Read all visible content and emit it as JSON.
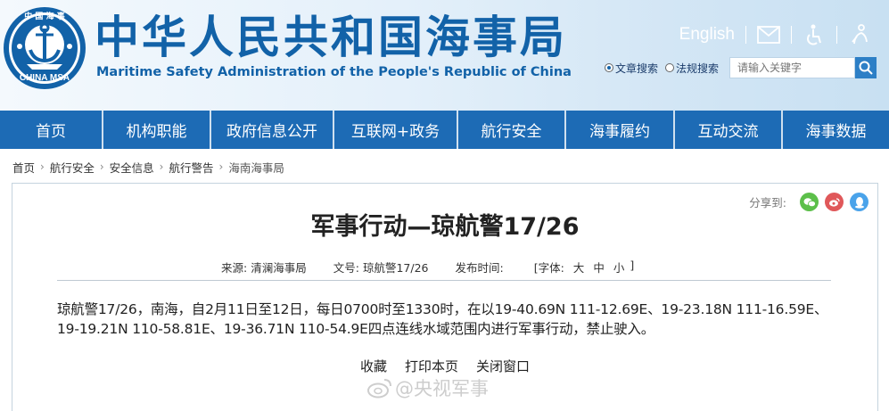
{
  "header": {
    "title_cn": "中华人民共和国海事局",
    "title_en": "Maritime Safety Administration of the People's Republic of China",
    "logo_text_top": "中 国 海 事",
    "logo_text_bottom": "CHINA MSA",
    "lang_link": "English",
    "icons": [
      "mail-icon",
      "accessibility-icon",
      "elder-care-icon"
    ],
    "search": {
      "option_articles": "文章搜索",
      "option_regulations": "法规搜索",
      "selected": "文章搜索",
      "placeholder": "请输入关键字"
    }
  },
  "nav": {
    "items": [
      "首页",
      "机构职能",
      "政府信息公开",
      "互联网+政务",
      "航行安全",
      "海事履约",
      "互动交流",
      "海事数据"
    ]
  },
  "breadcrumb": [
    "首页",
    "航行安全",
    "安全信息",
    "航行警告",
    "海南海事局"
  ],
  "article": {
    "share_label": "分享到:",
    "title": "军事行动—琼航警17/26",
    "meta": {
      "source_label": "来源:",
      "source": "清澜海事局",
      "doc_no_label": "文号:",
      "doc_no": "琼航警17/26",
      "time_label": "发布时间:",
      "time": "",
      "font_label": "[字体:",
      "font_large": "大",
      "font_medium": "中",
      "font_small": "小",
      "font_close": "]"
    },
    "body": "琼航警17/26，南海，自2月11日至12日，每日0700时至1330时，在以19-40.69N 111-12.69E、19-23.18N 111-16.59E、19-19.21N 110-58.81E、19-36.71N 110-54.9E四点连线水域范围内进行军事行动，禁止驶入。",
    "actions": [
      "收藏",
      "打印本页",
      "关闭窗口"
    ]
  },
  "watermark": "@央视军事",
  "colors": {
    "brand_blue": "#1262a8",
    "nav_blue": "#1d6bb5",
    "wechat": "#5cbf4a",
    "weibo": "#e0585a",
    "qq": "#4aa3ea"
  }
}
